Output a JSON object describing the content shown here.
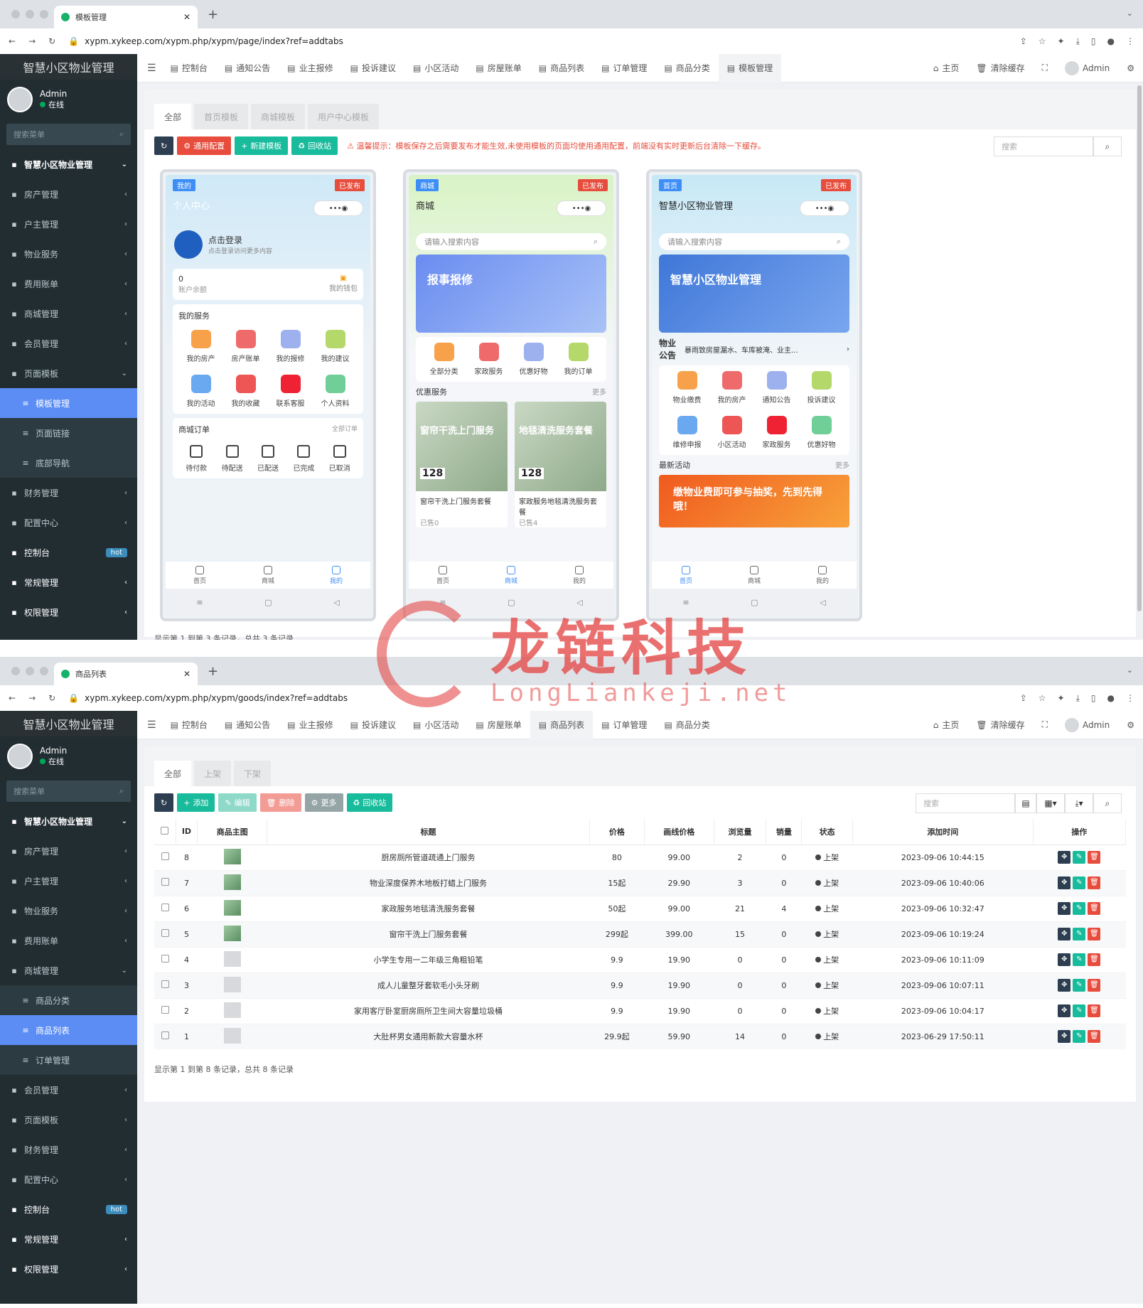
{
  "window1": {
    "tab_title": "模板管理",
    "url": "xypm.xykeep.com/xypm.php/xypm/page/index?ref=addtabs",
    "panel_tabs": [
      "全部",
      "首页模板",
      "商城模板",
      "用户中心模板"
    ],
    "toolbar": {
      "refresh_label": "",
      "config_label": "通用配置",
      "new_label": "新建模板",
      "recycle_label": "回收站"
    },
    "warning": "温馨提示：模板保存之后需要发布才能生效,未使用模板的页面均使用通用配置，前端没有实时更新后台清除一下缓存。",
    "search_placeholder": "搜索",
    "page_info": "显示第 1 到第 3 条记录，总共 3 条记录",
    "phones": [
      {
        "tag": "我的",
        "status": "已发布",
        "title": "个人中心",
        "login": "点击登录",
        "login_sub": "点击登录访问更多内容",
        "balance": "0",
        "balance_label": "账户余额",
        "wallet": "我的钱包",
        "services_title": "我的服务",
        "services": [
          "我的房产",
          "房产账单",
          "我的报修",
          "我的建议",
          "我的活动",
          "我的收藏",
          "联系客服",
          "个人资料"
        ],
        "orders_title": "商城订单",
        "orders_all": "全部订单",
        "orders": [
          "待付款",
          "待配送",
          "已配送",
          "已完成",
          "已取消"
        ],
        "tabs": [
          "首页",
          "商城",
          "我的"
        ]
      },
      {
        "tag": "商城",
        "status": "已发布",
        "title": "商城",
        "search": "请输入搜索内容",
        "banner": "报事报修",
        "cats": [
          "全部分类",
          "家政服务",
          "优惠好物",
          "我的订单"
        ],
        "sect": "优惠服务",
        "more": "更多",
        "products": [
          {
            "img": "窗帘干洗上门服务",
            "price": "128",
            "title": "窗帘干洗上门服务套餐",
            "sold": "已售0"
          },
          {
            "img": "地毯清洗服务套餐",
            "price": "128",
            "title": "家政服务地毯清洗服务套餐",
            "sold": "已售4"
          }
        ],
        "tabs": [
          "首页",
          "商城",
          "我的"
        ]
      },
      {
        "tag": "首页",
        "status": "已发布",
        "title": "智慧小区物业管理",
        "search": "请输入搜索内容",
        "banner": "智慧小区物业管理",
        "notice_tag": "物业公告",
        "notice": "暴雨致房屋漏水、车库被淹、业主...",
        "grid": [
          "物业缴费",
          "我的房产",
          "通知公告",
          "投诉建议",
          "维修申报",
          "小区活动",
          "家政服务",
          "优惠好物"
        ],
        "sect": "最新活动",
        "more": "更多",
        "promo": "缴物业费即可参与抽奖，先到先得哦！",
        "tabs": [
          "首页",
          "商城",
          "我的"
        ]
      }
    ],
    "nav_tabs": [
      "控制台",
      "通知公告",
      "业主报修",
      "投诉建议",
      "小区活动",
      "房屋账单",
      "商品列表",
      "订单管理",
      "商品分类",
      "模板管理"
    ],
    "active_nav": "模板管理"
  },
  "window2": {
    "tab_title": "商品列表",
    "url": "xypm.xykeep.com/xypm.php/xypm/goods/index?ref=addtabs",
    "panel_tabs": [
      "全部",
      "上架",
      "下架"
    ],
    "toolbar": {
      "add_label": "添加",
      "edit_label": "编辑",
      "delete_label": "删除",
      "more_label": "更多",
      "recycle_label": "回收站"
    },
    "search_placeholder": "搜索",
    "columns": [
      "ID",
      "商品主图",
      "标题",
      "价格",
      "画线价格",
      "浏览量",
      "销量",
      "状态",
      "添加时间",
      "操作"
    ],
    "rows": [
      {
        "id": "8",
        "title": "厨房厕所管道疏通上门服务",
        "price": "80",
        "line_price": "99.00",
        "views": "2",
        "sales": "0",
        "status": "上架",
        "time": "2023-09-06 10:44:15",
        "img": "g"
      },
      {
        "id": "7",
        "title": "物业深度保养木地板打蜡上门服务",
        "price": "15起",
        "line_price": "29.90",
        "views": "3",
        "sales": "0",
        "status": "上架",
        "time": "2023-09-06 10:40:06",
        "img": "g"
      },
      {
        "id": "6",
        "title": "家政服务地毯清洗服务套餐",
        "price": "50起",
        "line_price": "99.00",
        "views": "21",
        "sales": "4",
        "status": "上架",
        "time": "2023-09-06 10:32:47",
        "img": "g"
      },
      {
        "id": "5",
        "title": "窗帘干洗上门服务套餐",
        "price": "299起",
        "line_price": "399.00",
        "views": "15",
        "sales": "0",
        "status": "上架",
        "time": "2023-09-06 10:19:24",
        "img": "g"
      },
      {
        "id": "4",
        "title": "小学生专用一二年级三角粗铅笔",
        "price": "9.9",
        "line_price": "19.90",
        "views": "0",
        "sales": "0",
        "status": "上架",
        "time": "2023-09-06 10:11:09",
        "img": "p"
      },
      {
        "id": "3",
        "title": "成人儿童整牙套软毛小头牙刷",
        "price": "9.9",
        "line_price": "19.90",
        "views": "0",
        "sales": "0",
        "status": "上架",
        "time": "2023-09-06 10:07:11",
        "img": "p"
      },
      {
        "id": "2",
        "title": "家用客厅卧室厨房厕所卫生间大容量垃圾桶",
        "price": "9.9",
        "line_price": "19.90",
        "views": "0",
        "sales": "0",
        "status": "上架",
        "time": "2023-09-06 10:04:17",
        "img": "p"
      },
      {
        "id": "1",
        "title": "大肚杯男女通用新款大容量水杯",
        "price": "29.9起",
        "line_price": "59.90",
        "views": "14",
        "sales": "0",
        "status": "上架",
        "time": "2023-06-29 17:50:11",
        "img": "p"
      }
    ],
    "page_info": "显示第 1 到第 8 条记录，总共 8 条记录",
    "nav_tabs": [
      "控制台",
      "通知公告",
      "业主报修",
      "投诉建议",
      "小区活动",
      "房屋账单",
      "商品列表",
      "订单管理",
      "商品分类"
    ],
    "active_nav": "商品列表"
  },
  "common": {
    "brand": "智慧小区物业管理",
    "user": "Admin",
    "online": "在线",
    "search_menu": "搜索菜单",
    "nav_home": "主页",
    "nav_clear": "清除缓存",
    "nav_user": "Admin"
  },
  "sidebar1": [
    {
      "label": "智慧小区物业管理",
      "type": "hdr"
    },
    {
      "label": "房产管理",
      "type": "item"
    },
    {
      "label": "户主管理",
      "type": "item"
    },
    {
      "label": "物业服务",
      "type": "item"
    },
    {
      "label": "费用账单",
      "type": "item"
    },
    {
      "label": "商城管理",
      "type": "item"
    },
    {
      "label": "会员管理",
      "type": "item"
    },
    {
      "label": "页面模板",
      "type": "open"
    },
    {
      "label": "模板管理",
      "type": "act"
    },
    {
      "label": "页面链接",
      "type": "sub"
    },
    {
      "label": "底部导航",
      "type": "sub"
    },
    {
      "label": "财务管理",
      "type": "item"
    },
    {
      "label": "配置中心",
      "type": "item"
    },
    {
      "label": "控制台",
      "type": "top",
      "badge": "hot"
    },
    {
      "label": "常规管理",
      "type": "top"
    },
    {
      "label": "权限管理",
      "type": "top"
    }
  ],
  "sidebar2": [
    {
      "label": "智慧小区物业管理",
      "type": "hdr"
    },
    {
      "label": "房产管理",
      "type": "item"
    },
    {
      "label": "户主管理",
      "type": "item"
    },
    {
      "label": "物业服务",
      "type": "item"
    },
    {
      "label": "费用账单",
      "type": "item"
    },
    {
      "label": "商城管理",
      "type": "open"
    },
    {
      "label": "商品分类",
      "type": "sub"
    },
    {
      "label": "商品列表",
      "type": "act"
    },
    {
      "label": "订单管理",
      "type": "sub"
    },
    {
      "label": "会员管理",
      "type": "item"
    },
    {
      "label": "页面模板",
      "type": "item"
    },
    {
      "label": "财务管理",
      "type": "item"
    },
    {
      "label": "配置中心",
      "type": "item"
    },
    {
      "label": "控制台",
      "type": "top",
      "badge": "hot"
    },
    {
      "label": "常规管理",
      "type": "top"
    },
    {
      "label": "权限管理",
      "type": "top"
    }
  ],
  "watermark": {
    "cn": "龙链科技",
    "en": "LongLiankeji.net"
  },
  "colors": {
    "sidebar": "#222d32",
    "active": "#5b8df5",
    "danger": "#e74c3c",
    "success": "#18bc9c",
    "dark": "#2c3e50"
  }
}
